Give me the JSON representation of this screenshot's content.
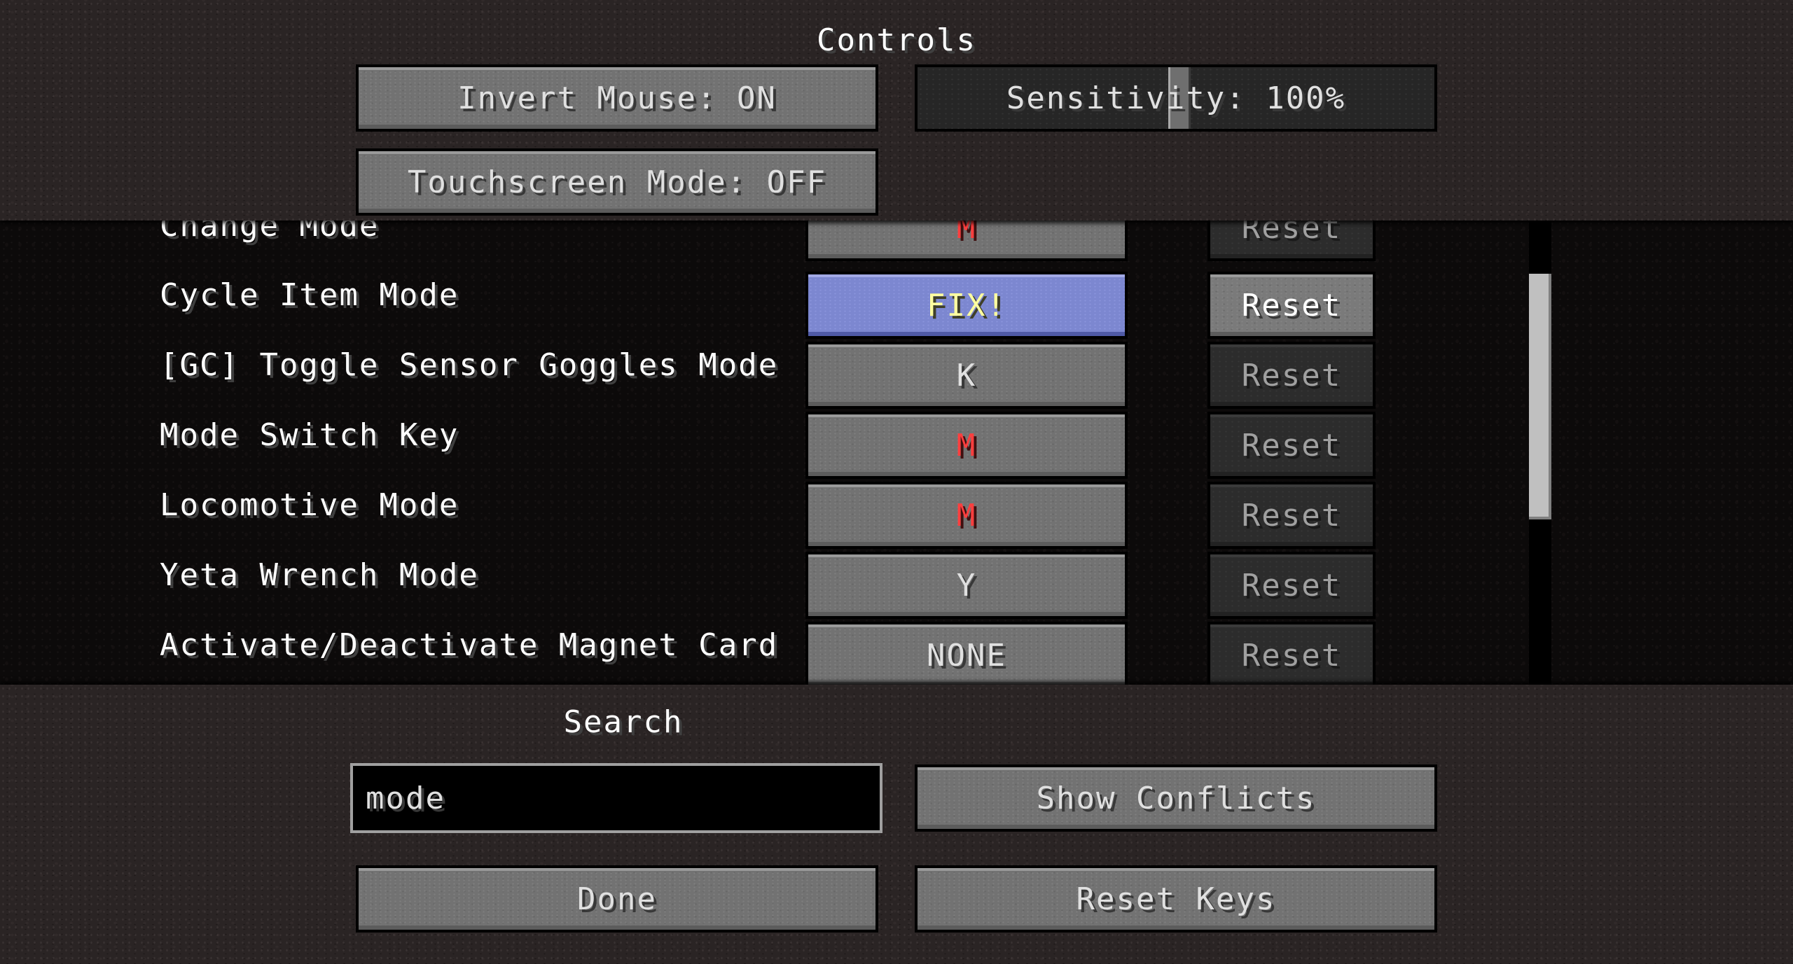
{
  "screen": {
    "title": "Controls"
  },
  "top_buttons": {
    "invert_mouse": "Invert Mouse: ON",
    "sensitivity": "Sensitivity: 100%",
    "sensitivity_value": 1.0,
    "touchscreen": "Touchscreen Mode: OFF"
  },
  "keybinds": [
    {
      "label": "Change Mode",
      "key": "M",
      "key_color": "red",
      "reset": "Reset",
      "reset_enabled": false
    },
    {
      "label": "Cycle Item Mode",
      "key": "FIX!",
      "key_color": "highlight",
      "reset": "Reset",
      "reset_enabled": true
    },
    {
      "label": "[GC] Toggle Sensor Goggles Mode",
      "key": "K",
      "key_color": "normal",
      "reset": "Reset",
      "reset_enabled": false
    },
    {
      "label": "Mode Switch Key",
      "key": "M",
      "key_color": "red",
      "reset": "Reset",
      "reset_enabled": false
    },
    {
      "label": "Locomotive Mode",
      "key": "M",
      "key_color": "red",
      "reset": "Reset",
      "reset_enabled": false
    },
    {
      "label": "Yeta Wrench Mode",
      "key": "Y",
      "key_color": "normal",
      "reset": "Reset",
      "reset_enabled": false
    },
    {
      "label": "Activate/Deactivate Magnet Card",
      "key": "NONE",
      "key_color": "normal",
      "reset": "Reset",
      "reset_enabled": false
    }
  ],
  "search": {
    "label": "Search",
    "value": "mode"
  },
  "bottom_buttons": {
    "show_conflicts": "Show Conflicts",
    "done": "Done",
    "reset_keys": "Reset Keys"
  },
  "colors": {
    "key_red": "#ff3e3e",
    "highlight_text": "#ffffa0",
    "highlight_bg": "#7c87d0"
  },
  "scroll": {
    "position_fraction": 0.22,
    "visible_fraction": 0.53
  }
}
